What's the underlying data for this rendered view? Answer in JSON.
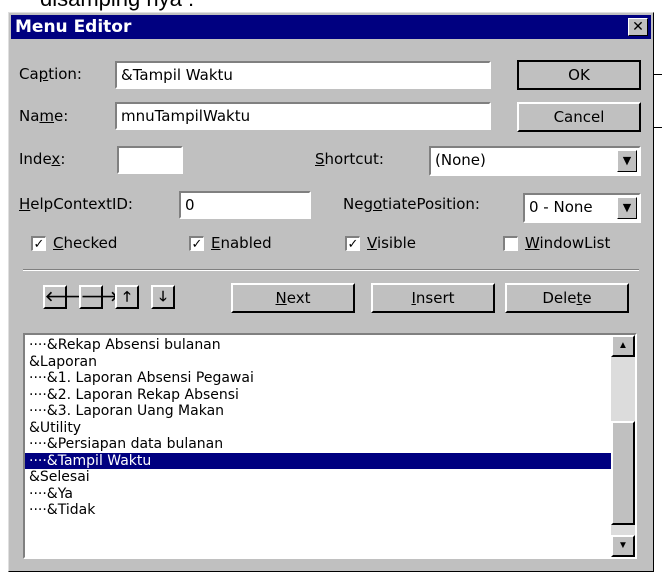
{
  "window": {
    "title": "Menu Editor",
    "close_glyph": "✕"
  },
  "caption": {
    "label_pre": "Ca",
    "label_u": "p",
    "label_post": "tion:",
    "value": "&Tampil Waktu"
  },
  "name": {
    "label_pre": "Na",
    "label_u": "m",
    "label_post": "e:",
    "value": "mnuTampilWaktu"
  },
  "index": {
    "label_pre": "Inde",
    "label_u": "x",
    "label_post": ":",
    "value": ""
  },
  "shortcut": {
    "label_u": "S",
    "label_post": "hortcut:",
    "value": "(None)"
  },
  "help": {
    "label_u": "H",
    "label_post": "elpContextID:",
    "value": "0"
  },
  "negotiate": {
    "label_pre": "Neg",
    "label_u": "o",
    "label_post": "tiatePosition:",
    "value": "0 - None"
  },
  "checks": {
    "checked": {
      "label_u": "C",
      "label_post": "hecked",
      "state": true
    },
    "enabled": {
      "label_u": "E",
      "label_post": "nabled",
      "state": true
    },
    "visible": {
      "label_u": "V",
      "label_post": "isible",
      "state": true
    },
    "windowlist": {
      "label_u": "W",
      "label_post": "indowList",
      "state": false
    }
  },
  "buttons": {
    "ok": "OK",
    "cancel": "Cancel",
    "next_u": "N",
    "next_post": "ext",
    "insert_u": "I",
    "insert_post": "nsert",
    "delete_pre": "Dele",
    "delete_u": "t",
    "delete_post": "e"
  },
  "arrows": {
    "left": "🡐",
    "right": "🡒",
    "up": "🡑",
    "down": "🡓"
  },
  "menu_items": [
    "····&Rekap Absensi bulanan",
    "&Laporan",
    "····&1. Laporan Absensi Pegawai",
    "····&2. Laporan Rekap Absensi",
    "····&3. Laporan Uang Makan",
    "&Utility",
    "····&Persiapan data bulanan",
    "····&Tampil Waktu",
    "&Selesai",
    "····&Ya",
    "····&Tidak"
  ],
  "selected_index": 7,
  "top_text": "disamping nya :"
}
